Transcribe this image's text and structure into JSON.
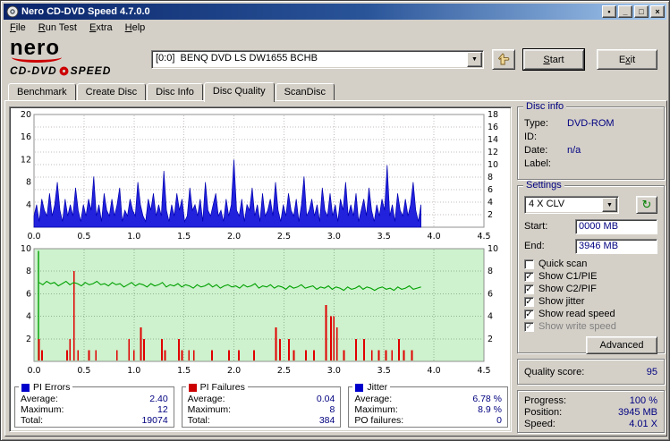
{
  "window": {
    "title": "Nero CD-DVD Speed 4.7.0.0"
  },
  "icons": {
    "check": "✓",
    "dropdown_arrow": "▼",
    "refresh": "↻",
    "minimize": "_",
    "maximize": "□",
    "close": "×",
    "extra": "▪"
  },
  "menu": {
    "items": [
      {
        "accel": "F",
        "rest": "ile"
      },
      {
        "accel": "R",
        "rest": "un Test"
      },
      {
        "accel": "E",
        "rest": "xtra"
      },
      {
        "accel": "H",
        "rest": "elp"
      }
    ]
  },
  "header": {
    "logo": {
      "brand": "nero",
      "line2_left": "CD-DVD",
      "line2_right": "SPEED"
    },
    "drive_select": "[0:0]  BENQ DVD LS DW1655 BCHB",
    "start_button": {
      "accel": "S",
      "rest": "tart"
    },
    "exit_button": {
      "pre": "E",
      "accel": "x",
      "rest": "it"
    }
  },
  "tabs": [
    {
      "label": "Benchmark",
      "active": false
    },
    {
      "label": "Create Disc",
      "active": false
    },
    {
      "label": "Disc Info",
      "active": false
    },
    {
      "label": "Disc Quality",
      "active": true
    },
    {
      "label": "ScanDisc",
      "active": false
    }
  ],
  "disc_info": {
    "title": "Disc info",
    "rows": [
      {
        "label": "Type:",
        "value": "DVD-ROM"
      },
      {
        "label": "ID:",
        "value": ""
      },
      {
        "label": "Date:",
        "value": "n/a"
      },
      {
        "label": "Label:",
        "value": ""
      }
    ]
  },
  "settings": {
    "title": "Settings",
    "speed_select": "4 X CLV",
    "start_label": "Start:",
    "start_value": "0000 MB",
    "end_label": "End:",
    "end_value": "3946 MB",
    "checkboxes": [
      {
        "label": "Quick scan",
        "checked": false,
        "enabled": true
      },
      {
        "label": "Show C1/PIE",
        "checked": true,
        "enabled": true
      },
      {
        "label": "Show C2/PIF",
        "checked": true,
        "enabled": true
      },
      {
        "label": "Show jitter",
        "checked": true,
        "enabled": true
      },
      {
        "label": "Show read speed",
        "checked": true,
        "enabled": true
      },
      {
        "label": "Show write speed",
        "checked": true,
        "enabled": false
      }
    ],
    "advanced_button": "Advanced"
  },
  "quality": {
    "label": "Quality score:",
    "value": "95"
  },
  "progress": {
    "rows": [
      {
        "label": "Progress:",
        "value": "100 %"
      },
      {
        "label": "Position:",
        "value": "3945 MB"
      },
      {
        "label": "Speed:",
        "value": "4.01 X"
      }
    ]
  },
  "stats": [
    {
      "title": "PI Errors",
      "color": "#0000cc",
      "rows": [
        {
          "label": "Average:",
          "value": "2.40"
        },
        {
          "label": "Maximum:",
          "value": "12"
        },
        {
          "label": "Total:",
          "value": "19074"
        }
      ]
    },
    {
      "title": "PI Failures",
      "color": "#cc0000",
      "rows": [
        {
          "label": "Average:",
          "value": "0.04"
        },
        {
          "label": "Maximum:",
          "value": "8"
        },
        {
          "label": "Total:",
          "value": "384"
        }
      ]
    },
    {
      "title": "Jitter",
      "color": "#0000cc",
      "rows": [
        {
          "label": "Average:",
          "value": "6.78 %"
        },
        {
          "label": "Maximum:",
          "value": "8.9 %"
        },
        {
          "label": "PO failures:",
          "value": "0"
        }
      ]
    }
  ],
  "chart_data": [
    {
      "type": "area",
      "name": "PI Errors (C1/PIE) trace",
      "x_unit": "GB",
      "x_range": [
        0,
        4.5
      ],
      "x_ticks": [
        "0.0",
        "0.5",
        "1.0",
        "1.5",
        "2.0",
        "2.5",
        "3.0",
        "3.5",
        "4.0",
        "4.5"
      ],
      "y_left": {
        "range": [
          0,
          20
        ],
        "ticks": [
          4,
          8,
          12,
          16,
          20
        ]
      },
      "y_right": {
        "range": [
          0,
          18
        ],
        "ticks": [
          2,
          4,
          6,
          8,
          10,
          12,
          14,
          16,
          18
        ]
      },
      "series_color": "#2222dd",
      "series_stroke": "#0000b0",
      "end_x": 3.87,
      "values": [
        2,
        4,
        1,
        5,
        3,
        2,
        6,
        2,
        4,
        8,
        3,
        1,
        5,
        2,
        4,
        2,
        7,
        3,
        1,
        4,
        2,
        5,
        3,
        9,
        2,
        4,
        1,
        6,
        3,
        2,
        5,
        2,
        4,
        7,
        1,
        3,
        2,
        5,
        3,
        2,
        8,
        4,
        2,
        1,
        5,
        3,
        6,
        2,
        4,
        2,
        10,
        3,
        1,
        4,
        2,
        6,
        3,
        5,
        1,
        2,
        7,
        3,
        4,
        2,
        5,
        1,
        8,
        3,
        2,
        4,
        6,
        2,
        3,
        1,
        5,
        2,
        4,
        12,
        3,
        2,
        5,
        1,
        4,
        3,
        7,
        2,
        4,
        1,
        6,
        2,
        3,
        5,
        2,
        8,
        3,
        1,
        4,
        2,
        6,
        3,
        2,
        5,
        1,
        4,
        9,
        2,
        3,
        5,
        2,
        4,
        1,
        7,
        3,
        2,
        6,
        2,
        4,
        1,
        5,
        3,
        8,
        2,
        4,
        2,
        6,
        1,
        3,
        5,
        2,
        7,
        3,
        1,
        4,
        2,
        5,
        3,
        11,
        2,
        4,
        1,
        6,
        3,
        2,
        5,
        2,
        4,
        8,
        3,
        1,
        4
      ]
    },
    {
      "type": "mixed",
      "name": "PI Failures (bars) and Jitter (line)",
      "x_unit": "GB",
      "background": "#cdf2cd",
      "x_range": [
        0,
        4.5
      ],
      "x_ticks": [
        "0.0",
        "0.5",
        "1.0",
        "1.5",
        "2.0",
        "2.5",
        "3.0",
        "3.5",
        "4.0",
        "4.5"
      ],
      "y_left": {
        "range": [
          0,
          10
        ],
        "ticks": [
          2,
          4,
          6,
          8,
          10
        ]
      },
      "y_right": {
        "range": [
          0,
          10
        ],
        "ticks": [
          2,
          4,
          6,
          8,
          10
        ]
      },
      "end_x": 3.87,
      "jitter_color": "#00a000",
      "pif_color": "#e00000",
      "start_spike": {
        "x": 0.045,
        "height": 9.8
      },
      "jitter_start_x": 0.05,
      "jitter_values": [
        7.0,
        6.8,
        7.1,
        6.9,
        7.0,
        6.7,
        6.9,
        7.1,
        6.8,
        7.0,
        6.9,
        6.7,
        7.0,
        6.8,
        6.9,
        7.1,
        6.8,
        6.9,
        6.7,
        7.0,
        6.8,
        6.9,
        6.6,
        6.8,
        7.0,
        6.7,
        6.9,
        6.8,
        6.6,
        6.9,
        6.7,
        6.8,
        7.0,
        6.6,
        6.8,
        6.7,
        6.9,
        6.6,
        6.8,
        6.7,
        6.5,
        6.8,
        6.6,
        6.7,
        6.9,
        6.6,
        6.8,
        6.5,
        6.7,
        6.8,
        6.6,
        6.7,
        6.5,
        6.8,
        6.6,
        6.7,
        6.9,
        6.5,
        6.7,
        6.6,
        6.8,
        6.5,
        6.7,
        6.6,
        6.4,
        6.7,
        6.5,
        6.6,
        6.8,
        6.5,
        6.6,
        6.7,
        6.4,
        6.6,
        6.5,
        6.7,
        6.4,
        6.6,
        6.5,
        6.3,
        6.6,
        6.4,
        6.5,
        6.7,
        6.4,
        6.6,
        6.5,
        6.3,
        6.5,
        6.6,
        6.4,
        6.5,
        6.3,
        6.6,
        6.4,
        6.5,
        6.7,
        6.4,
        6.5,
        6.6
      ],
      "pif_spikes": [
        [
          0.05,
          2
        ],
        [
          0.08,
          1
        ],
        [
          0.33,
          1
        ],
        [
          0.36,
          2
        ],
        [
          0.4,
          8
        ],
        [
          0.44,
          1
        ],
        [
          0.55,
          1
        ],
        [
          0.62,
          1
        ],
        [
          0.83,
          1
        ],
        [
          0.95,
          2
        ],
        [
          1.0,
          1
        ],
        [
          1.07,
          3
        ],
        [
          1.1,
          2
        ],
        [
          1.28,
          2
        ],
        [
          1.31,
          1
        ],
        [
          1.45,
          2
        ],
        [
          1.48,
          1
        ],
        [
          1.55,
          1
        ],
        [
          1.6,
          1
        ],
        [
          1.78,
          1
        ],
        [
          1.95,
          1
        ],
        [
          2.05,
          1
        ],
        [
          2.2,
          1
        ],
        [
          2.42,
          3
        ],
        [
          2.46,
          2
        ],
        [
          2.55,
          2
        ],
        [
          2.6,
          1
        ],
        [
          2.72,
          1
        ],
        [
          2.8,
          1
        ],
        [
          2.92,
          5
        ],
        [
          2.97,
          4
        ],
        [
          3.0,
          4
        ],
        [
          3.03,
          3
        ],
        [
          3.1,
          1
        ],
        [
          3.22,
          2
        ],
        [
          3.3,
          2
        ],
        [
          3.38,
          1
        ],
        [
          3.45,
          1
        ],
        [
          3.52,
          1
        ],
        [
          3.58,
          1
        ],
        [
          3.65,
          2
        ],
        [
          3.7,
          1
        ],
        [
          3.78,
          1
        ]
      ]
    }
  ]
}
